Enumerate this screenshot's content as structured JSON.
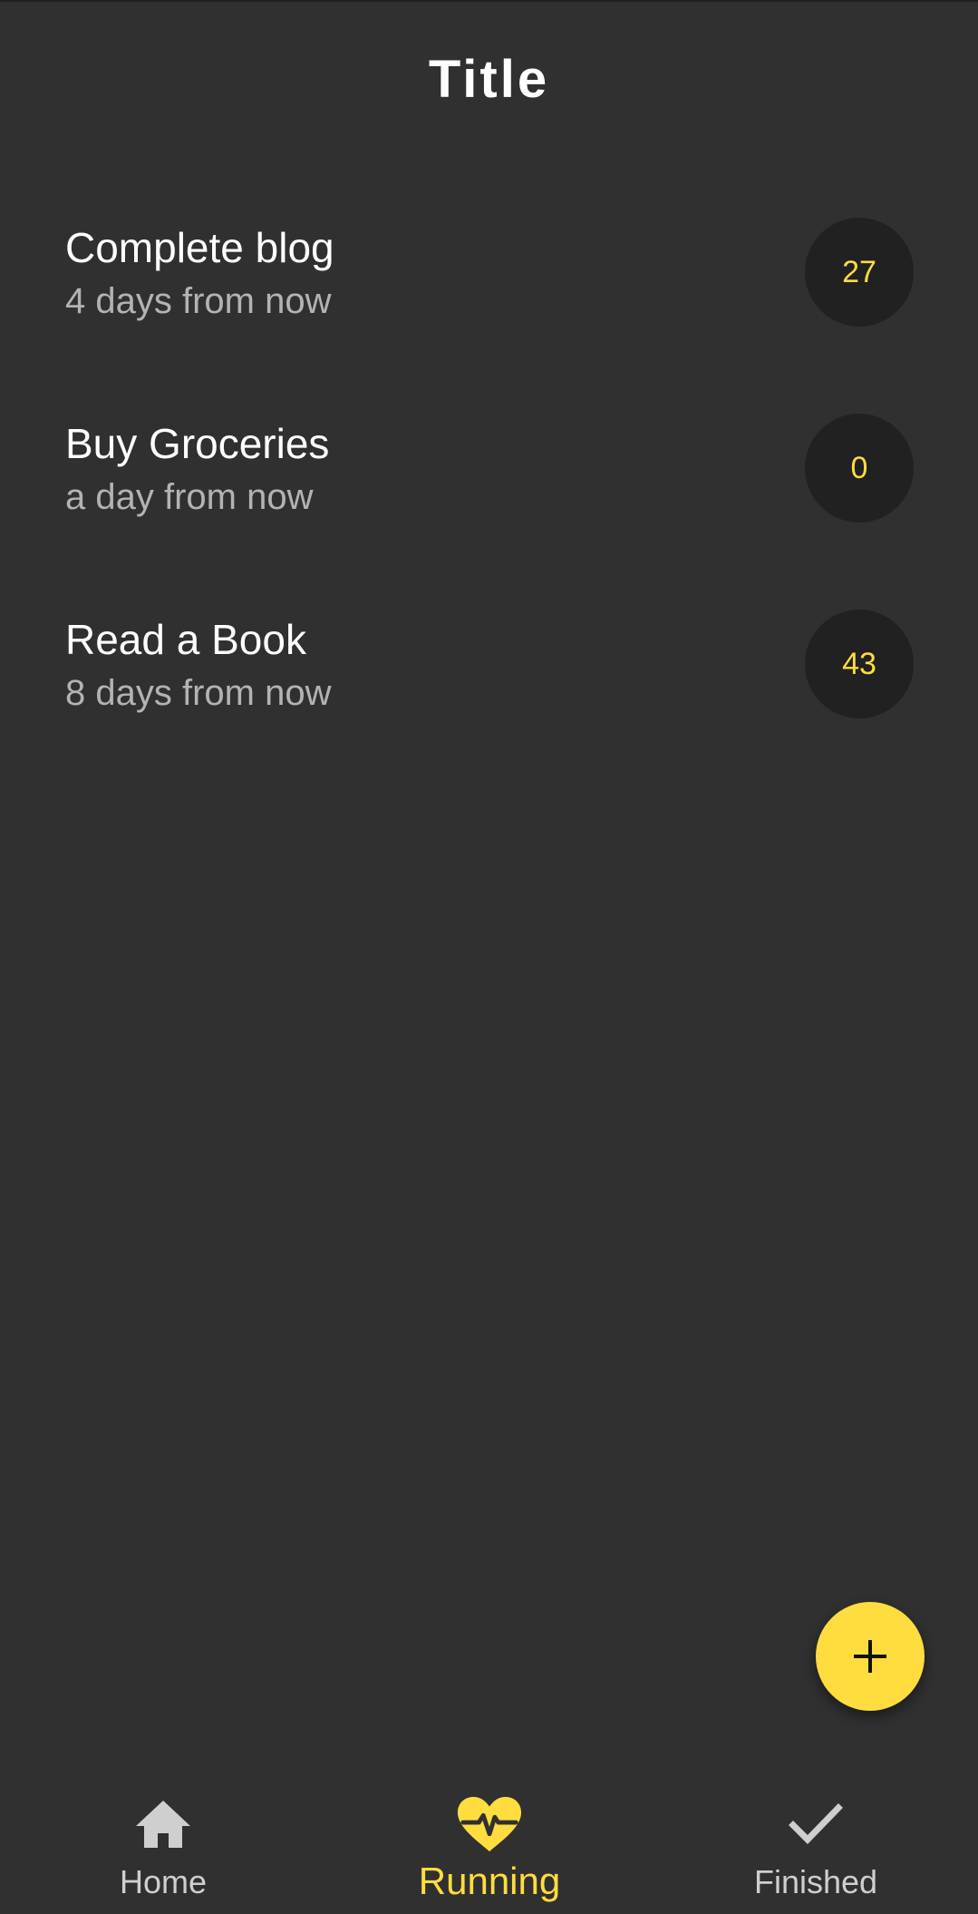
{
  "app_bar": {
    "title": "Title"
  },
  "tasks": [
    {
      "title": "Complete blog",
      "due": "4 days from now",
      "count": "27"
    },
    {
      "title": "Buy Groceries",
      "due": "a day from now",
      "count": "0"
    },
    {
      "title": "Read a Book",
      "due": "8 days from now",
      "count": "43"
    }
  ],
  "fab": {
    "icon": "plus-icon"
  },
  "bottom_nav": {
    "items": [
      {
        "label": "Home",
        "icon": "home-icon",
        "active": false
      },
      {
        "label": "Running",
        "icon": "heart-pulse-icon",
        "active": true
      },
      {
        "label": "Finished",
        "icon": "checkmark-icon",
        "active": false
      }
    ]
  },
  "colors": {
    "background": "#303030",
    "accent": "#FFDD3F",
    "avatar": "#212121",
    "secondary_text": "#B3B3B3",
    "inactive_nav": "#CFCFCF"
  }
}
